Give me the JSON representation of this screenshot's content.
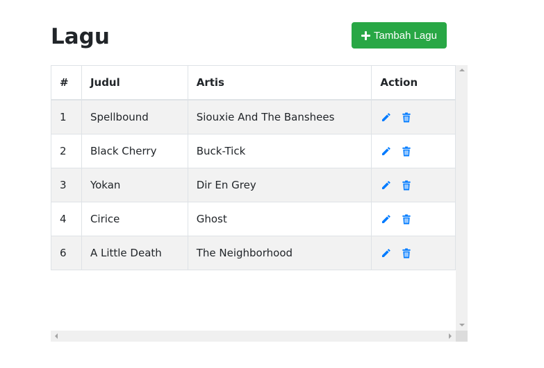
{
  "page": {
    "title": "Lagu"
  },
  "toolbar": {
    "add_label": "Tambah Lagu",
    "add_icon": "plus-icon",
    "add_color": "#28a745"
  },
  "table": {
    "columns": [
      "#",
      "Judul",
      "Artis",
      "Action"
    ],
    "rows": [
      {
        "no": "1",
        "judul": "Spellbound",
        "artis": "Siouxie And The Banshees"
      },
      {
        "no": "2",
        "judul": "Black Cherry",
        "artis": "Buck-Tick"
      },
      {
        "no": "3",
        "judul": "Yokan",
        "artis": "Dir En Grey"
      },
      {
        "no": "4",
        "judul": "Cirice",
        "artis": "Ghost"
      },
      {
        "no": "6",
        "judul": "A Little Death",
        "artis": "The Neighborhood"
      }
    ],
    "action_icons": [
      "pencil-icon",
      "trash-icon"
    ],
    "action_color": "#007bff",
    "stripe_color": "#f2f2f2"
  }
}
